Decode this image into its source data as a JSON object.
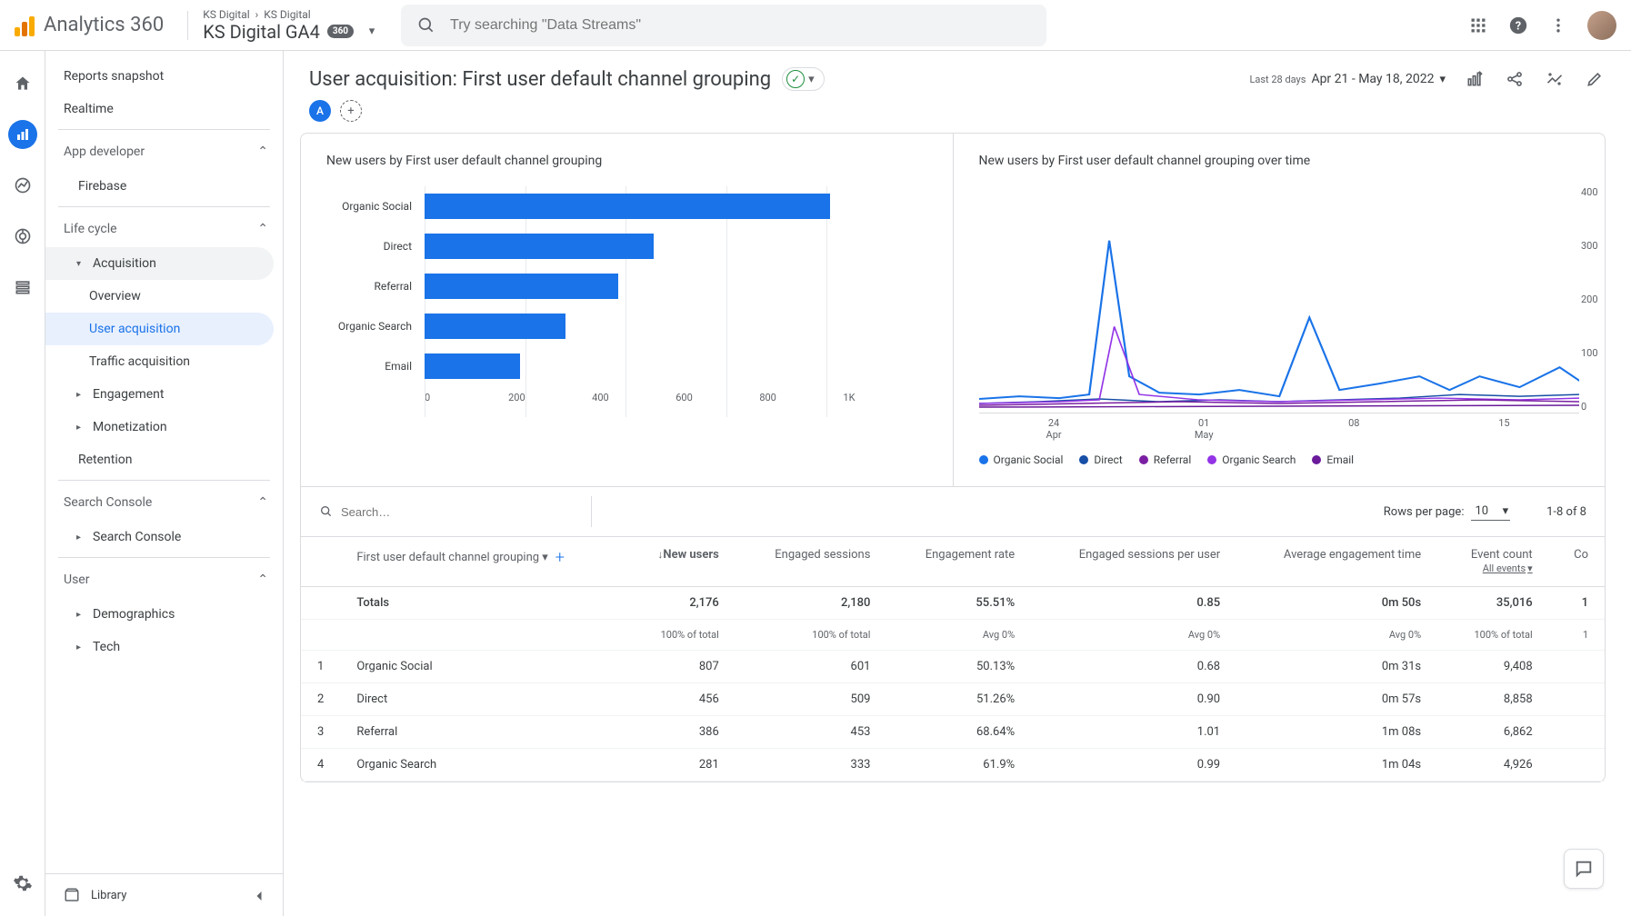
{
  "header": {
    "product": "Analytics 360",
    "breadcrumb1": "KS Digital",
    "breadcrumb2": "KS Digital",
    "property": "KS Digital GA4",
    "badge": "360",
    "search_placeholder": "Try searching \"Data Streams\""
  },
  "sidebar": {
    "reports_snapshot": "Reports snapshot",
    "realtime": "Realtime",
    "app_dev": "App developer",
    "firebase": "Firebase",
    "life_cycle": "Life cycle",
    "acquisition": "Acquisition",
    "overview": "Overview",
    "user_acq": "User acquisition",
    "traffic_acq": "Traffic acquisition",
    "engagement": "Engagement",
    "monetization": "Monetization",
    "retention": "Retention",
    "search_console": "Search Console",
    "search_console_item": "Search Console",
    "user": "User",
    "demographics": "Demographics",
    "tech": "Tech",
    "library": "Library"
  },
  "report": {
    "title": "User acquisition: First user default channel grouping",
    "date_tag": "Last 28 days",
    "date_text": "Apr 21 - May 18, 2022",
    "chip": "A"
  },
  "chart_data": [
    {
      "type": "bar",
      "title": "New users by First user default channel grouping",
      "categories": [
        "Organic Social",
        "Direct",
        "Referral",
        "Organic Search",
        "Email"
      ],
      "values": [
        807,
        456,
        386,
        281,
        190
      ],
      "xticks": [
        "0",
        "200",
        "400",
        "600",
        "800",
        "1K"
      ],
      "xlim": [
        0,
        1000
      ]
    },
    {
      "type": "line",
      "title": "New users by First user default channel grouping over time",
      "yticks": [
        "400",
        "300",
        "200",
        "100",
        "0"
      ],
      "ylim": [
        0,
        400
      ],
      "xticks": [
        "24\nApr",
        "01\nMay",
        "08",
        "15"
      ],
      "series": [
        {
          "name": "Organic Social",
          "color": "#1a73e8"
        },
        {
          "name": "Direct",
          "color": "#174ea6"
        },
        {
          "name": "Referral",
          "color": "#7b1fa2"
        },
        {
          "name": "Organic Search",
          "color": "#9334e6"
        },
        {
          "name": "Email",
          "color": "#6a1b9a"
        }
      ]
    }
  ],
  "table": {
    "search_placeholder": "Search…",
    "rows_per_page_label": "Rows per page:",
    "rows_per_page_value": "10",
    "page_info": "1-8 of 8",
    "dim_header": "First user default channel grouping",
    "columns": {
      "new_users": "New users",
      "engaged_sessions": "Engaged sessions",
      "engagement_rate": "Engagement rate",
      "engaged_per_user": "Engaged sessions per user",
      "avg_engagement_time": "Average engagement time",
      "event_count": "Event count",
      "event_sub": "All events",
      "co": "Co"
    },
    "totals_label": "Totals",
    "totals": {
      "new_users": "2,176",
      "engaged_sessions": "2,180",
      "engagement_rate": "55.51%",
      "engaged_per_user": "0.85",
      "avg_engagement_time": "0m 50s",
      "event_count": "35,016",
      "co": "1"
    },
    "totals_sub": {
      "new_users": "100% of total",
      "engaged_sessions": "100% of total",
      "engagement_rate": "Avg 0%",
      "engaged_per_user": "Avg 0%",
      "avg_engagement_time": "Avg 0%",
      "event_count": "100% of total",
      "co": "1"
    },
    "rows": [
      {
        "n": "1",
        "dim": "Organic Social",
        "new_users": "807",
        "engaged_sessions": "601",
        "engagement_rate": "50.13%",
        "engaged_per_user": "0.68",
        "avg": "0m 31s",
        "event_count": "9,408"
      },
      {
        "n": "2",
        "dim": "Direct",
        "new_users": "456",
        "engaged_sessions": "509",
        "engagement_rate": "51.26%",
        "engaged_per_user": "0.90",
        "avg": "0m 57s",
        "event_count": "8,858"
      },
      {
        "n": "3",
        "dim": "Referral",
        "new_users": "386",
        "engaged_sessions": "453",
        "engagement_rate": "68.64%",
        "engaged_per_user": "1.01",
        "avg": "1m 08s",
        "event_count": "6,862"
      },
      {
        "n": "4",
        "dim": "Organic Search",
        "new_users": "281",
        "engaged_sessions": "333",
        "engagement_rate": "61.9%",
        "engaged_per_user": "0.99",
        "avg": "1m 04s",
        "event_count": "4,926"
      }
    ]
  }
}
